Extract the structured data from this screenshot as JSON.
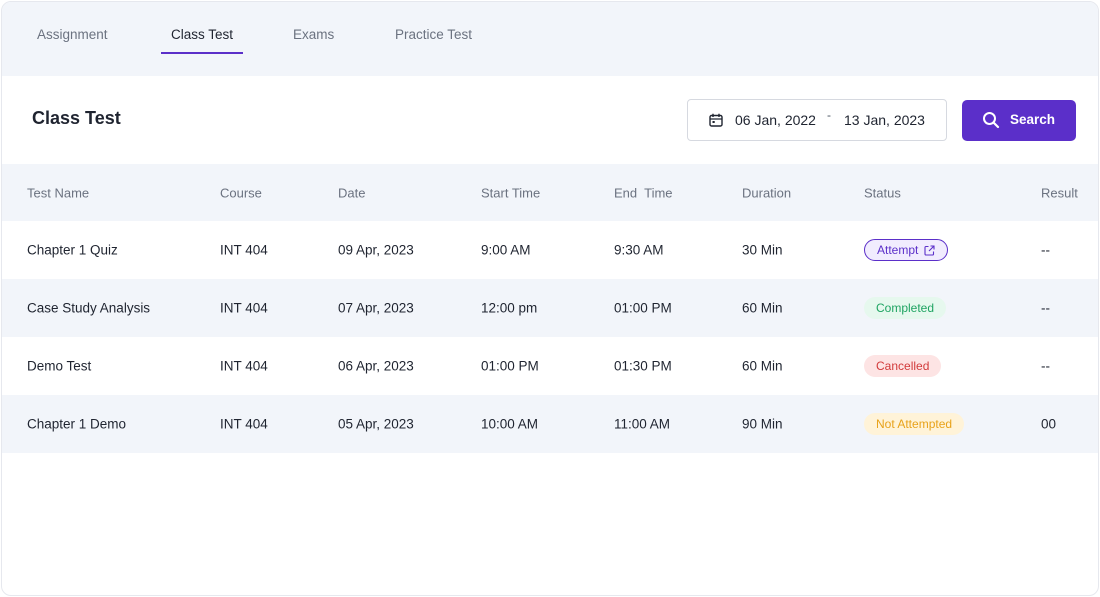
{
  "tabs": [
    {
      "label": "Assignment"
    },
    {
      "label": "Class Test"
    },
    {
      "label": "Exams"
    },
    {
      "label": "Practice Test"
    }
  ],
  "active_tab": "Class Test",
  "page_title": "Class Test",
  "date_range": {
    "from": "06 Jan, 2022",
    "separator": "-",
    "to": "13 Jan, 2023",
    "icon": "calendar-icon"
  },
  "search_button": {
    "label": "Search",
    "icon": "search-icon"
  },
  "table": {
    "columns": [
      "Test Name",
      "Course",
      "Date",
      "Start Time",
      "End  Time",
      "Duration",
      "Status",
      "Result"
    ],
    "rows": [
      {
        "name": "Chapter 1 Quiz",
        "course": "INT 404",
        "date": "09 Apr, 2023",
        "start": "9:00 AM",
        "end": "9:30 AM",
        "duration": "30 Min",
        "status": "Attempt",
        "result": "--"
      },
      {
        "name": "Case Study Analysis",
        "course": "INT 404",
        "date": "07 Apr, 2023",
        "start": "12:00 pm",
        "end": "01:00 PM",
        "duration": "60 Min",
        "status": "Completed",
        "result": "--"
      },
      {
        "name": "Demo Test",
        "course": "INT 404",
        "date": "06 Apr, 2023",
        "start": "01:00 PM",
        "end": "01:30 PM",
        "duration": "60 Min",
        "status": "Cancelled",
        "result": "--"
      },
      {
        "name": "Chapter 1 Demo",
        "course": "INT 404",
        "date": "05 Apr, 2023",
        "start": "10:00 AM",
        "end": "11:00 AM",
        "duration": "90 Min",
        "status": "Not Attempted",
        "result": "00"
      }
    ]
  },
  "colors": {
    "accent": "#5b2fc9",
    "completed": "#1fa462",
    "cancelled": "#d23b3b",
    "not_attempted": "#e8a21a"
  }
}
